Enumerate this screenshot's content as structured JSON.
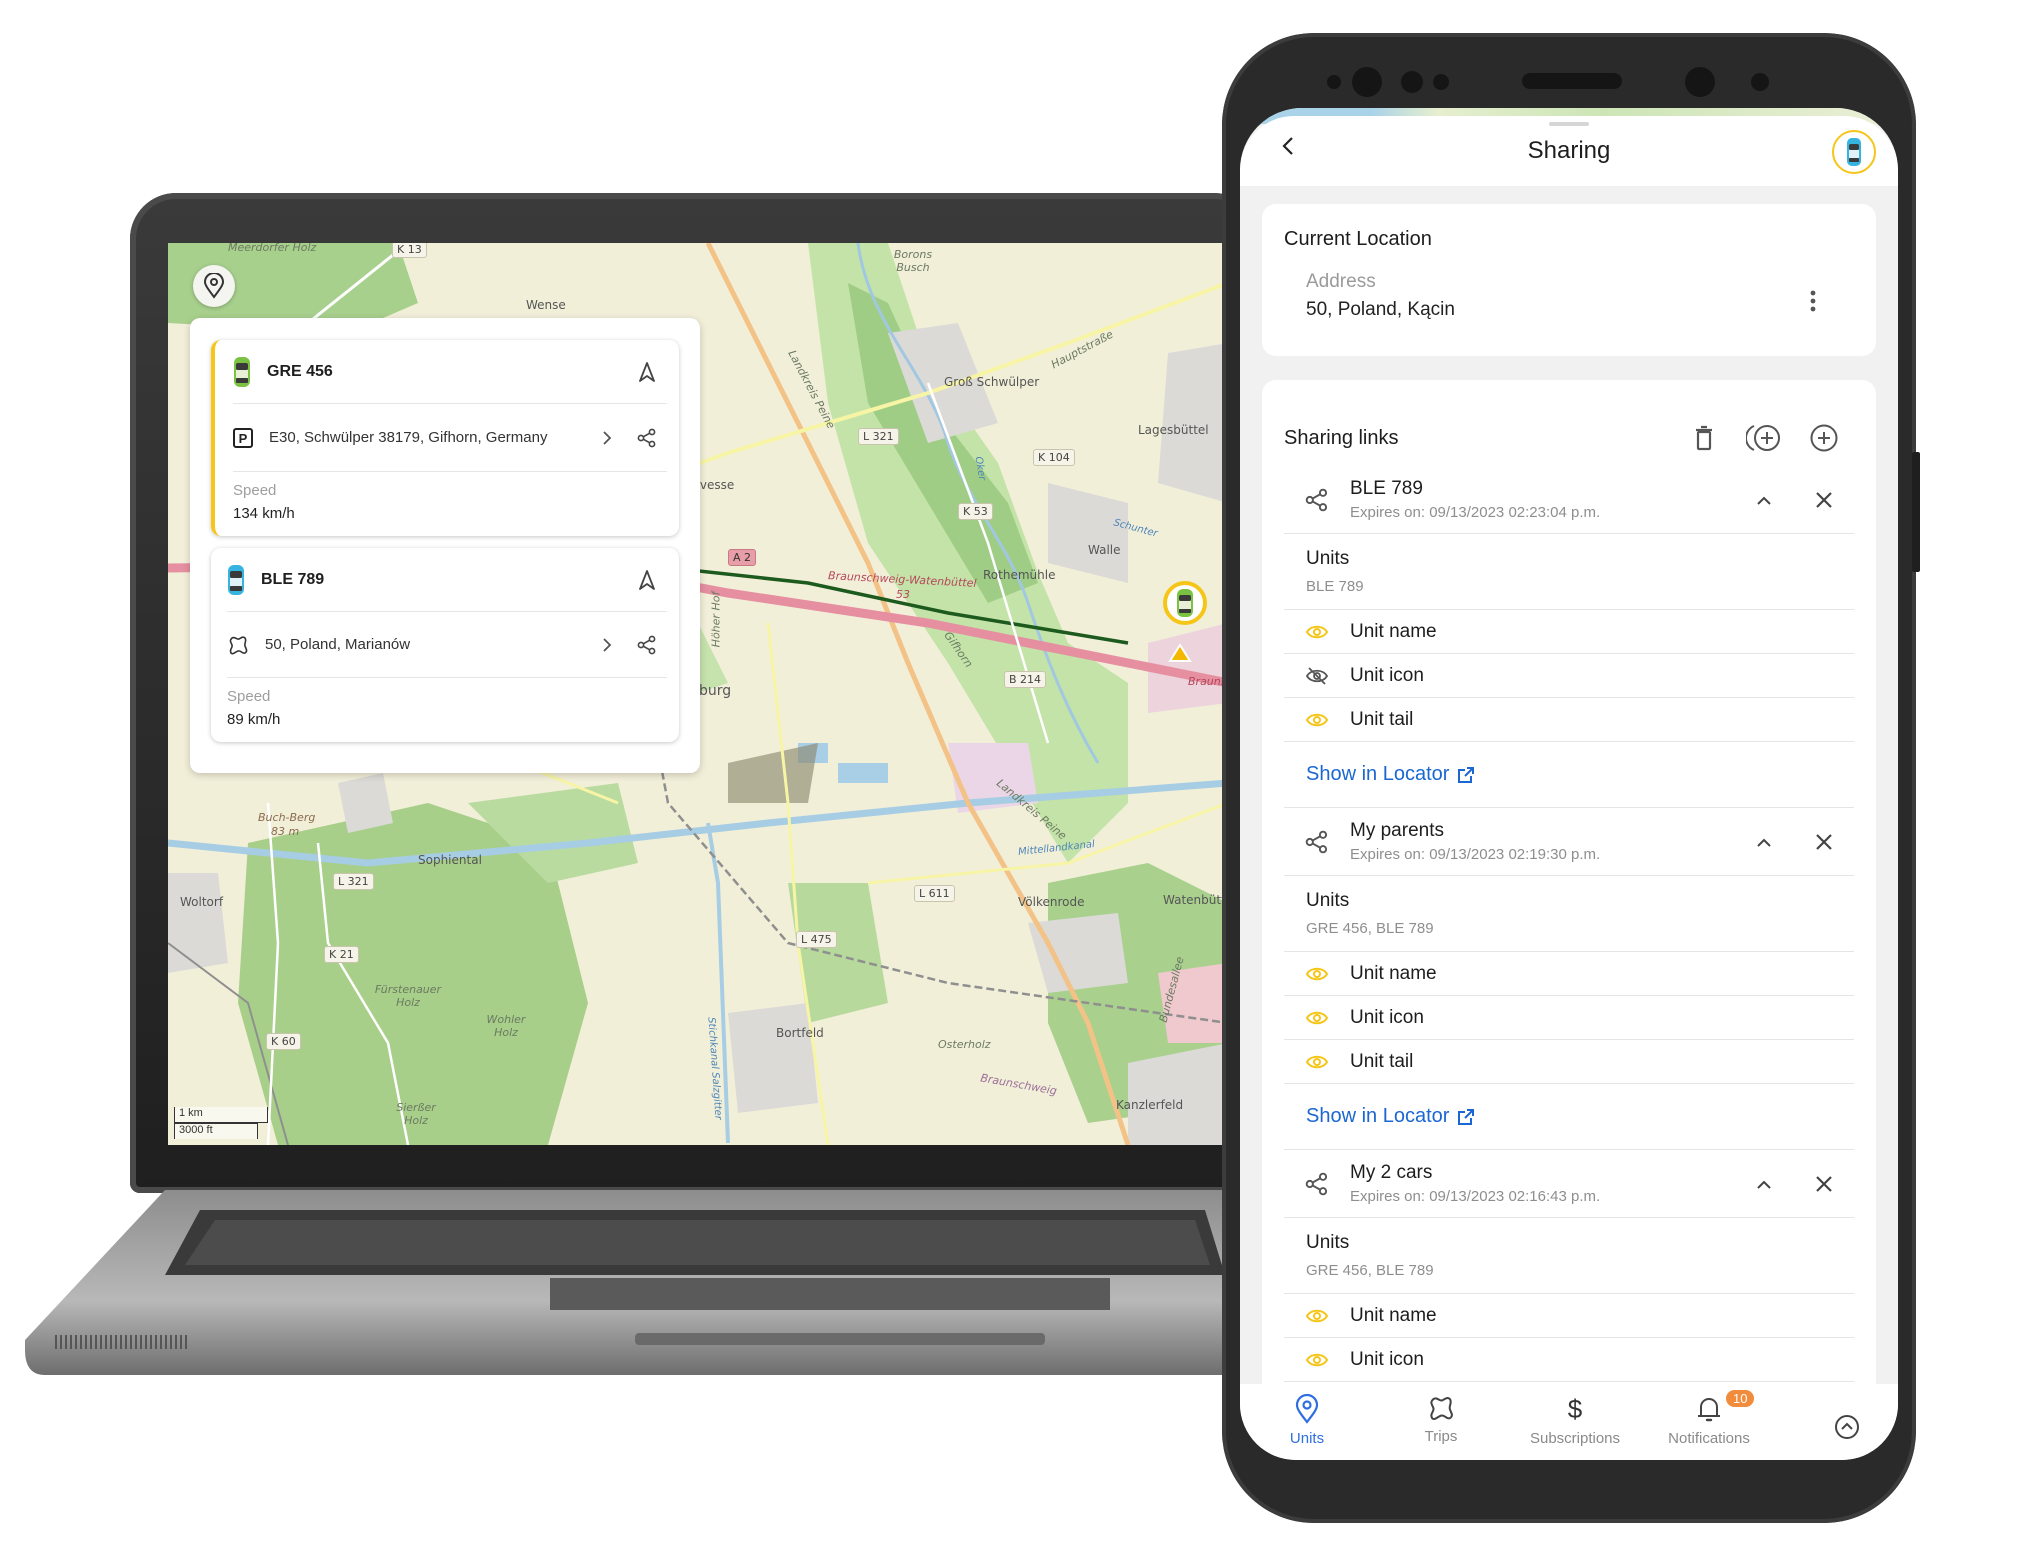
{
  "laptop": {
    "map": {
      "labels": {
        "wense": "Wense",
        "gross_schwulper": "Groß Schwülper",
        "hauptstrasse": "Hauptstraße",
        "lagesbuttel": "Lagesbüttel",
        "walle": "Walle",
        "rothemuhle": "Rothemühle",
        "schunter": "Schunter",
        "oker": "Oker",
        "borons_busch": "Borons Busch",
        "rvesse": "rvesse",
        "burg": "burg",
        "hoher_hof": "Höher Hof",
        "gifhorn": "Gifhorn",
        "landkreis_peine": "Landkreis Peine",
        "braunschweig_watenbuttel": "Braunschweig-Watenbüttel",
        "exit_53": "53",
        "braunschweig_edge": "Brauns",
        "buch_berg": "Buch-Berg",
        "buch_berg_elev": "83 m",
        "sophiental": "Sophiental",
        "woltorf": "Woltorf",
        "furstenauer_holz": "Fürstenauer Holz",
        "wohler_holz": "Wohler Holz",
        "sierber_holz": "Sierßer Holz",
        "bortfeld": "Bortfeld",
        "volkenrode": "Völkenrode",
        "watenbuttel": "Watenbüttel",
        "osterholz": "Osterholz",
        "braunschweig": "Braunschweig",
        "kanzlerfeld": "Kanzlerfeld",
        "mittellandkanal": "Mittellandkanal",
        "stichkanal": "Stichkanal Salzgitter",
        "bundesallee": "Bundesallee",
        "meerdorfer_holz": "Meerdorfer Holz"
      },
      "road_shields": {
        "k13": "K 13",
        "l321_top": "L 321",
        "k104": "K 104",
        "k53": "K 53",
        "a2": "A 2",
        "b214": "B 214",
        "l321_bottom": "L 321",
        "k21": "K 21",
        "k60": "K 60",
        "l611": "L 611",
        "l475": "L 475"
      },
      "scale": {
        "metric": "1 km",
        "imperial": "3000 ft"
      }
    },
    "units": [
      {
        "name": "GRE 456",
        "icon": "car-green-icon",
        "status_icon": "parking-icon",
        "address": "E30, Schwülper 38179, Gifhorn, Germany",
        "speed_label": "Speed",
        "speed_value": "134 km/h",
        "selected": true,
        "color": "#7cc242"
      },
      {
        "name": "BLE 789",
        "icon": "car-blue-icon",
        "status_icon": "trip-icon",
        "address": "50, Poland, Marianów",
        "speed_label": "Speed",
        "speed_value": "89 km/h",
        "selected": false,
        "color": "#35b4e0"
      }
    ]
  },
  "phone": {
    "header": {
      "title": "Sharing"
    },
    "current_location": {
      "title": "Current Location",
      "address_label": "Address",
      "address_value": "50, Poland, Kącin"
    },
    "sharing_links": {
      "title": "Sharing links",
      "show_in_locator_label": "Show in Locator",
      "units_label": "Units",
      "items": [
        {
          "name": "BLE 789",
          "expires": "Expires on: 09/13/2023 02:23:04 p.m.",
          "units": "BLE 789",
          "options": [
            {
              "label": "Unit name",
              "visible": true
            },
            {
              "label": "Unit icon",
              "visible": false
            },
            {
              "label": "Unit tail",
              "visible": true
            }
          ]
        },
        {
          "name": "My parents",
          "expires": "Expires on: 09/13/2023 02:19:30 p.m.",
          "units": "GRE 456, BLE 789",
          "options": [
            {
              "label": "Unit name",
              "visible": true
            },
            {
              "label": "Unit icon",
              "visible": true
            },
            {
              "label": "Unit tail",
              "visible": true
            }
          ]
        },
        {
          "name": "My 2 cars",
          "expires": "Expires on: 09/13/2023 02:16:43 p.m.",
          "units": "GRE 456, BLE 789",
          "options": [
            {
              "label": "Unit name",
              "visible": true
            },
            {
              "label": "Unit icon",
              "visible": true
            }
          ]
        }
      ]
    },
    "bottom_nav": {
      "items": [
        {
          "label": "Units",
          "active": true
        },
        {
          "label": "Trips",
          "active": false
        },
        {
          "label": "Subscriptions",
          "active": false
        },
        {
          "label": "Notifications",
          "active": false,
          "badge": "10"
        }
      ]
    },
    "colors": {
      "accent": "#f5c518",
      "link": "#1a67d2",
      "nav_active": "#2e6fe0",
      "badge": "#f08c3c"
    }
  }
}
